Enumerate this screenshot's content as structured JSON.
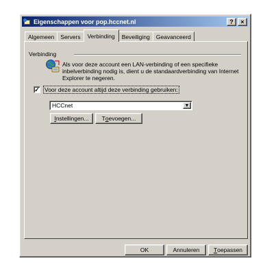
{
  "window": {
    "title": "Eigenschappen voor pop.hccnet.nl",
    "help_label": "?",
    "close_label": "×"
  },
  "tabs": [
    {
      "label": "Algemeen"
    },
    {
      "label": "Servers"
    },
    {
      "label": "Verbinding",
      "active": true
    },
    {
      "label": "Beveiliging"
    },
    {
      "label": "Geavanceerd"
    }
  ],
  "connection": {
    "group_label": "Verbinding",
    "info_text": "Als voor deze account een LAN-verbinding of een specifieke inbelverbinding nodig is, dient u de standaardverbinding van Internet Explorer te negeren.",
    "always_use_label": "Voor deze account altijd deze verbinding gebruiken:",
    "always_use_checked": true,
    "connection_select_value": "HCCnet",
    "settings_button": {
      "prefix": "",
      "key": "I",
      "rest": "nstellingen..."
    },
    "add_button": {
      "prefix": "T",
      "key": "o",
      "rest": "evoegen..."
    }
  },
  "footer": {
    "ok_label": "OK",
    "cancel_label": "Annuleren",
    "apply_button": {
      "prefix": "",
      "key": "T",
      "rest": "oepassen"
    }
  },
  "icons": {
    "title_icon": "mail-globe-icon",
    "info_icon": "network-globe-icon",
    "combo_arrow": "chevron-down-icon"
  }
}
